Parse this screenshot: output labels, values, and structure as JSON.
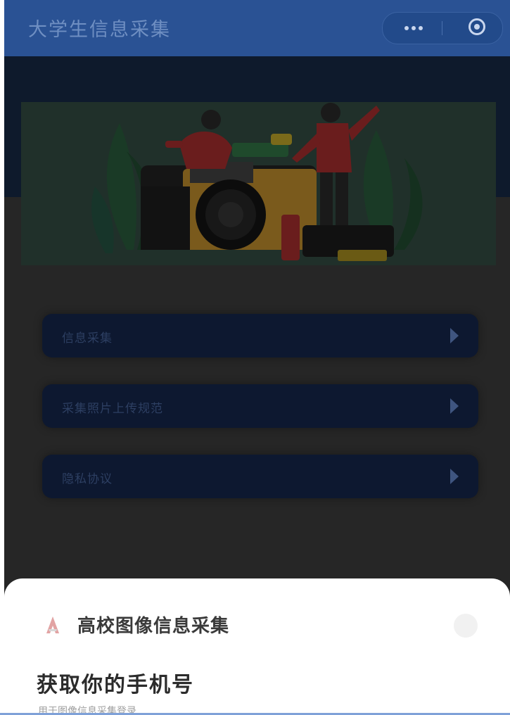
{
  "header": {
    "title": "大学生信息采集",
    "capsule": {
      "more_icon": "more-dots-icon",
      "close_icon": "close-circle-icon"
    }
  },
  "banner": {
    "illustration": "photographer-camera-illustration"
  },
  "menu": {
    "items": [
      {
        "label": "信息采集"
      },
      {
        "label": "采集照片上传规范"
      },
      {
        "label": "隐私协议"
      }
    ],
    "arrow_icon": "chevron-right-icon"
  },
  "auth_sheet": {
    "app_name": "高校图像信息采集",
    "heading": "获取你的手机号",
    "subtext": "用于图像信息采集登录",
    "logo_icon": "app-logo-icon",
    "help_icon": "help-circle-icon"
  },
  "colors": {
    "header": "#2a5294",
    "overlay_background": "#262626",
    "card": "#0d1830",
    "sheet": "#ffffff"
  }
}
